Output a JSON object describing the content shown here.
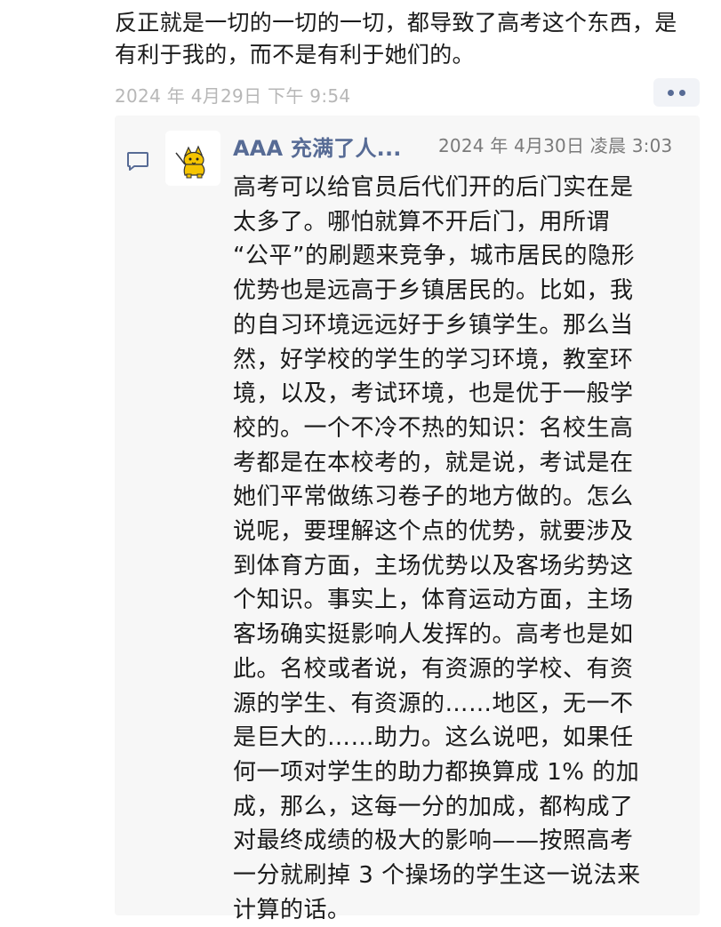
{
  "post": {
    "text_lines": [
      "反正就是一切的一切的一切，都导致了高考这个东西，是",
      "有利于我的，而不是有利于她们的。"
    ],
    "timestamp": "2024 年 4月29日 下午 9:54",
    "more_button_label": "••"
  },
  "comment": {
    "icon": "comment-icon",
    "avatar_icon": "yellow-cat-avatar",
    "author": "AAA 充满了人...",
    "timestamp": "2024 年 4月30日 凌晨 3:03",
    "text_lines": [
      "高考可以给官员后代们开的后门实在是",
      "太多了。哪怕就算不开后门，用所谓",
      "“公平”的刷题来竞争，城市居民的隐形",
      "优势也是远高于乡镇居民的。比如，我",
      "的自习环境远远好于乡镇学生。那么当",
      "然，好学校的学生的学习环境，教室环",
      "境，以及，考试环境，也是优于一般学",
      "校的。一个不冷不热的知识：名校生高",
      "考都是在本校考的，就是说，考试是在",
      "她们平常做练习卷子的地方做的。怎么",
      "说呢，要理解这个点的优势，就要涉及",
      "到体育方面，主场优势以及客场劣势这",
      "个知识。事实上，体育运动方面，主场",
      "客场确实挺影响人发挥的。高考也是如",
      "此。名校或者说，有资源的学校、有资",
      "源的学生、有资源的……地区，无一不",
      "是巨大的……助力。这么说吧，如果任",
      "何一项对学生的助力都换算成 1% 的加",
      "成，那么，这每一分的加成，都构成了",
      "对最终成绩的极大的影响——按照高考",
      "一分就刷掉 3 个操场的学生这一说法来",
      "计算的话。"
    ]
  },
  "colors": {
    "link_blue": "#576b95",
    "timestamp_gray": "#b7b7b7",
    "comment_bg": "#f7f7f7",
    "avatar_cat_yellow": "#f5c400"
  }
}
